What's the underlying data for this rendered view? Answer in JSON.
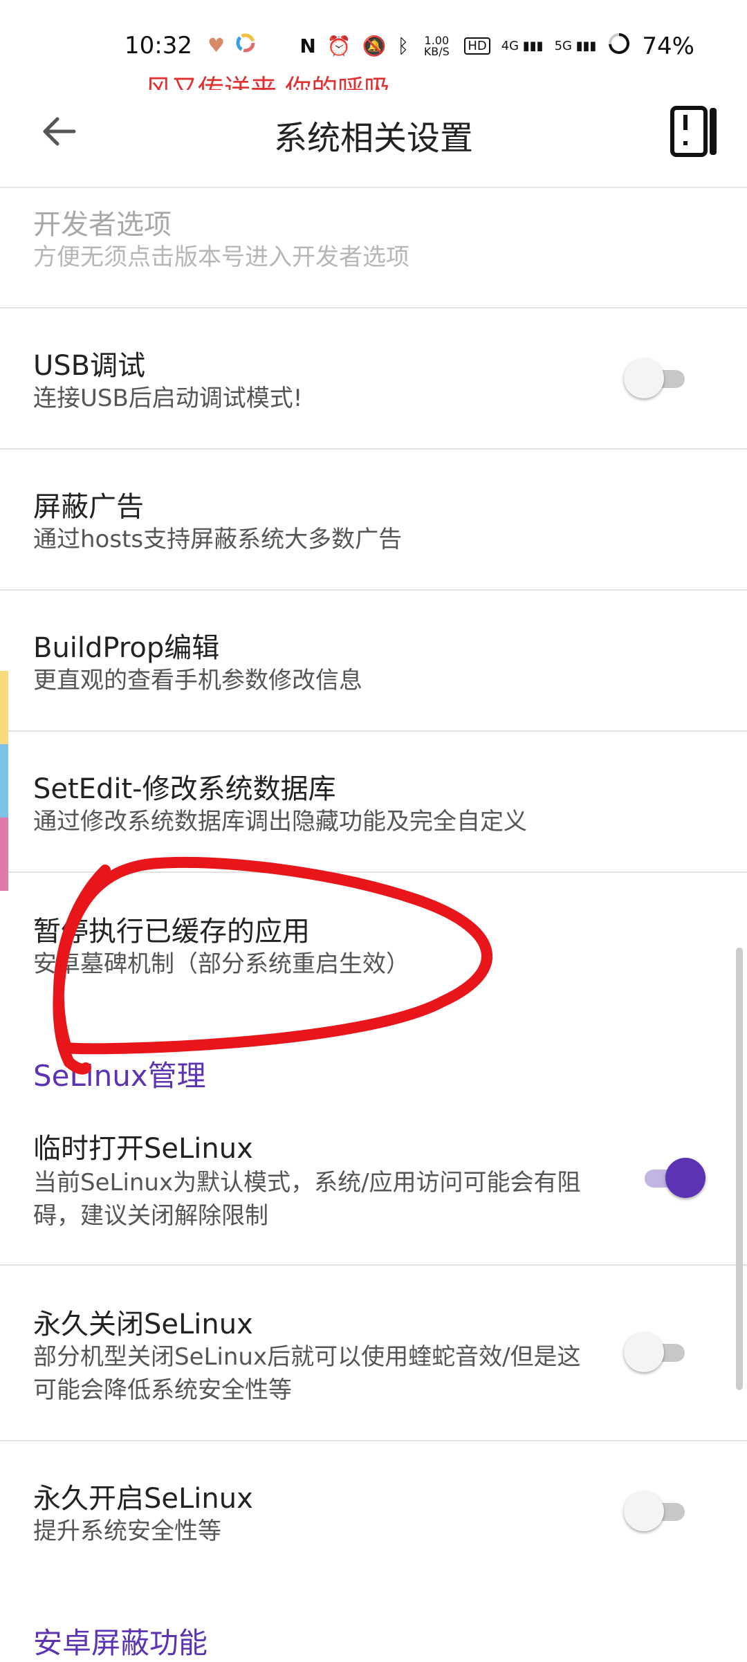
{
  "status_bar": {
    "time": "10:32",
    "net_speed": "1.00 KB/S",
    "hd_badge": "HD",
    "net_4g": "4G",
    "net_5g": "5G",
    "battery": "74%",
    "lyric": "风又传送来 你的呼吸"
  },
  "appbar": {
    "title": "系统相关设置",
    "back_icon": "arrow-left-icon",
    "right_icon": "device-icon"
  },
  "items": [
    {
      "title": "开发者选项",
      "subtitle": "方便无须点击版本号进入开发者选项",
      "enabled": false
    },
    {
      "title": "USB调试",
      "subtitle": "连接USB后启动调试模式!",
      "switch": false
    },
    {
      "title": "屏蔽广告",
      "subtitle": "通过hosts支持屏蔽系统大多数广告"
    },
    {
      "title": "BuildProp编辑",
      "subtitle": "更直观的查看手机参数修改信息"
    },
    {
      "title": "SetEdit-修改系统数据库",
      "subtitle": "通过修改系统数据库调出隐藏功能及完全自定义"
    },
    {
      "title": "暂停执行已缓存的应用",
      "subtitle": "安卓墓碑机制（部分系统重启生效）"
    }
  ],
  "selinux": {
    "header": "SeLinux管理",
    "items": [
      {
        "title": "临时打开SeLinux",
        "subtitle": "当前SeLinux为默认模式，系统/应用访问可能会有阻碍，建议关闭解除限制",
        "switch": true
      },
      {
        "title": "永久关闭SeLinux",
        "subtitle": "部分机型关闭SeLinux后就可以使用蝰蛇音效/但是这可能会降低系统安全性等",
        "switch": false
      },
      {
        "title": "永久开启SeLinux",
        "subtitle": "提升系统安全性等",
        "switch": false
      }
    ]
  },
  "next_section": {
    "header": "安卓屏蔽功能"
  },
  "colors": {
    "accent": "#5b33b3",
    "annotation_red": "#e8161b",
    "strip_yellow": "#f8d97e",
    "strip_blue": "#7ec2e8",
    "strip_pink": "#e17aa9"
  }
}
